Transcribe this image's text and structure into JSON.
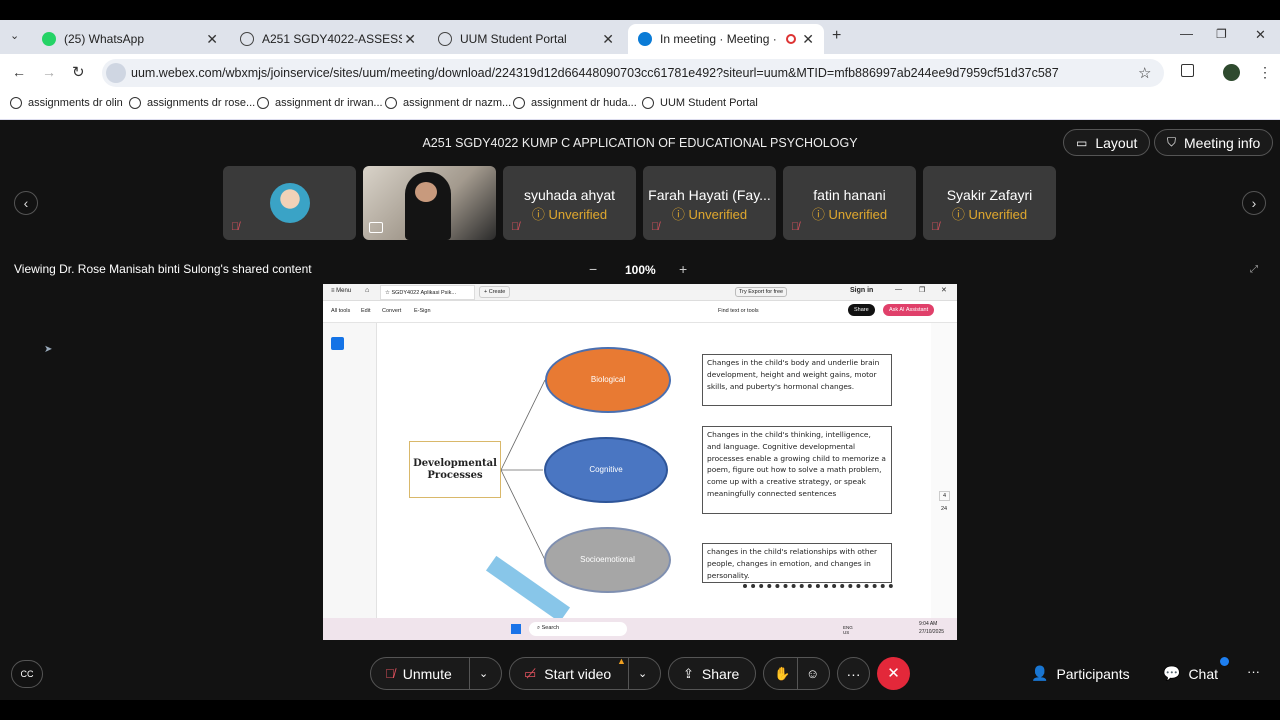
{
  "browser": {
    "tabs": [
      {
        "label": "(25) WhatsApp"
      },
      {
        "label": "A251 SGDY4022-ASSESSMENT..."
      },
      {
        "label": "UUM Student Portal"
      },
      {
        "label": "In meeting · Meeting · Webex"
      }
    ],
    "url": "uum.webex.com/wbxmjs/joinservice/sites/uum/meeting/download/224319d12d66448090703cc61781e492?siteurl=uum&MTID=mfb886997ab244ee9d7959cf51d37c587",
    "bookmarks": [
      {
        "label": "assignments dr olin"
      },
      {
        "label": "assignments dr rose..."
      },
      {
        "label": "assignment dr irwan..."
      },
      {
        "label": "assignment dr nazm..."
      },
      {
        "label": "assignment dr huda..."
      },
      {
        "label": "UUM Student Portal"
      }
    ]
  },
  "meeting": {
    "title": "A251 SGDY4022 KUMP C APPLICATION OF EDUCATIONAL PSYCHOLOGY",
    "layout_label": "Layout",
    "info_label": "Meeting info",
    "participants": [
      {
        "name": "syuhada ahyat",
        "status": "Unverified"
      },
      {
        "name": "Farah Hayati (Fay...",
        "status": "Unverified"
      },
      {
        "name": "fatin hanani",
        "status": "Unverified"
      },
      {
        "name": "Syakir Zafayri",
        "status": "Unverified"
      }
    ],
    "viewing": "Viewing Dr. Rose Manisah binti Sulong's shared content",
    "zoom": "100%",
    "zoom_minus": "−",
    "zoom_plus": "+"
  },
  "shared": {
    "app_menu": "Menu",
    "tab_title": "SGDY4022 Aplikasi Psik...",
    "create": "Create",
    "try_export": "Try Export for free",
    "sign_in": "Sign in",
    "menu_items": [
      "All tools",
      "Edit",
      "Convert",
      "E-Sign"
    ],
    "find": "Find text or tools",
    "share_btn": "Share",
    "ai_btn": "Ask AI Assistant",
    "center": "Developmental Processes",
    "nodes": [
      "Biological",
      "Cognitive",
      "Socioemotional"
    ],
    "descriptions": [
      "Changes in the child's body and underlie brain development, height and weight gains, motor skills, and puberty's hormonal changes.",
      "Changes in the child's thinking, intelligence, and language. Cognitive developmental processes enable a growing child to memorize a poem, figure out how to solve a math problem, come up with a creative strategy, or speak meaningfully connected sentences",
      "changes in the child's relationships with other people, changes in emotion, and changes in personality."
    ],
    "page_num": "4",
    "page_total": "24",
    "taskbar_search": "Search",
    "time": "9:04 AM",
    "date": "27/10/2025",
    "lang": "ENG US"
  },
  "controls": {
    "unmute": "Unmute",
    "start_video": "Start video",
    "share": "Share",
    "participants": "Participants",
    "chat": "Chat"
  }
}
